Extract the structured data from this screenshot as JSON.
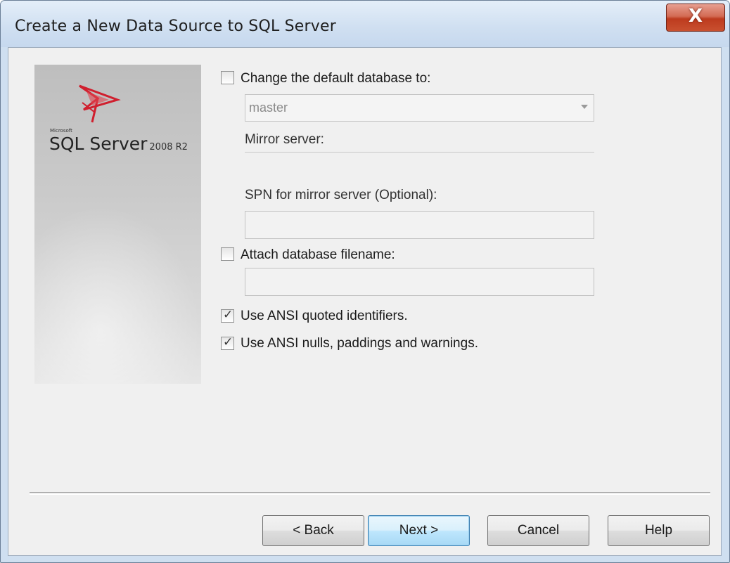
{
  "window": {
    "title": "Create a New Data Source to SQL Server",
    "close_label": "X"
  },
  "branding": {
    "vendor": "Microsoft",
    "product": "SQL Server",
    "version": "2008 R2"
  },
  "options": {
    "change_default_db": {
      "label": "Change the default database to:",
      "checked": false
    },
    "default_db_value": "master",
    "mirror_server_label": "Mirror server:",
    "mirror_server_value": "",
    "spn_label": "SPN for mirror server (Optional):",
    "spn_value": "",
    "attach_db": {
      "label": "Attach database filename:",
      "checked": false
    },
    "attach_db_value": "",
    "ansi_quoted": {
      "label": "Use ANSI quoted identifiers.",
      "checked": true
    },
    "ansi_nulls": {
      "label": "Use ANSI nulls, paddings and warnings.",
      "checked": true
    }
  },
  "buttons": {
    "back": "< Back",
    "next": "Next >",
    "cancel": "Cancel",
    "help": "Help"
  }
}
